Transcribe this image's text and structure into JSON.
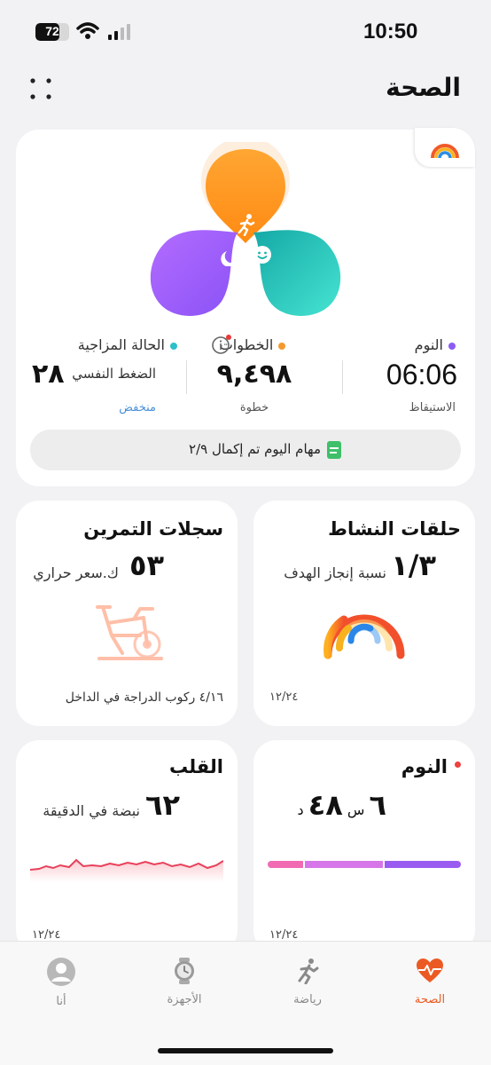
{
  "status": {
    "time": "10:50",
    "battery": "72",
    "battery_level": 0.72
  },
  "header": {
    "title": "الصحة",
    "menu_icon": "grid-dots-icon"
  },
  "summary": {
    "logo_icon": "rings-logo-icon",
    "petal_icons": [
      "running-person-icon",
      "sleep-moon-icon",
      "smile-face-icon"
    ],
    "colors": {
      "activity": "#ff9a1f",
      "sleep": "#9d5cff",
      "mood": "#2cc9b8"
    },
    "sleep": {
      "label": "النوم",
      "value": "06:06",
      "sub": "الاستيقاظ",
      "dot_color": "#8c5cf5"
    },
    "steps": {
      "label": "الخطوات",
      "value": "٩,٤٩٨",
      "sub": "خطوة",
      "dot_color": "#f49a2c",
      "info_icon": "info-icon"
    },
    "mood": {
      "label": "الحالة المزاجية",
      "value": "٢٨",
      "value_label": "الضغط النفسي",
      "sub": "منخفض",
      "dot_color": "#2cc0c9"
    },
    "tasks": {
      "text": "مهام اليوم تم إكمال ٢/٩",
      "icon": "document-icon"
    }
  },
  "activity_card": {
    "title": "حلقات النشاط",
    "value": "١/٣",
    "label": "نسبة إنجاز الهدف",
    "date": "١٢/٢٤",
    "icon": "activity-rings-icon"
  },
  "workout_card": {
    "title": "سجلات التمرين",
    "value": "٥٣",
    "label": "ك.سعر حراري",
    "footer": "٤/١٦ ركوب الدراجة في الداخل",
    "icon": "stationary-bike-icon"
  },
  "sleep_card": {
    "title": "النوم",
    "value_hours": "٦",
    "unit_hours": "س",
    "value_minutes": "٤٨",
    "unit_minutes": "د",
    "date": "١٢/٢٤",
    "dot_color": "#f04040"
  },
  "heart_card": {
    "title": "القلب",
    "value": "٦٢",
    "label": "نبضة في الدقيقة",
    "date": "١٢/٢٤"
  },
  "tabs": [
    {
      "label": "الصحة",
      "icon": "heart-pulse-icon",
      "active": true
    },
    {
      "label": "رياضة",
      "icon": "running-icon",
      "active": false
    },
    {
      "label": "الأجهزة",
      "icon": "watch-icon",
      "active": false
    },
    {
      "label": "أنا",
      "icon": "profile-icon",
      "active": false
    }
  ]
}
